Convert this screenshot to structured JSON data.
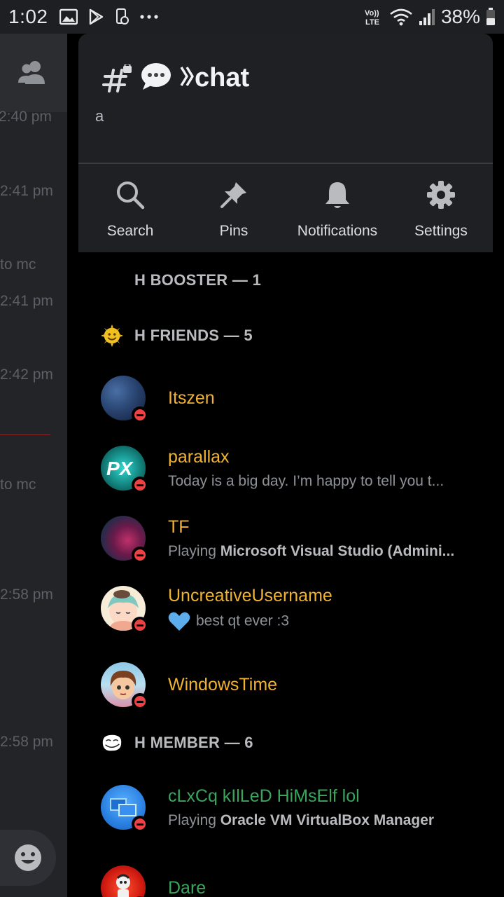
{
  "status_bar": {
    "time": "1:02",
    "battery_percent": "38%",
    "network_label": "Vo)) LTE"
  },
  "background_pane": {
    "timestamps": [
      "2:40 pm",
      "2:41 pm",
      "to mc",
      "2:41 pm",
      "2:42 pm",
      "to mc",
      "2:58 pm",
      "2:58 pm"
    ]
  },
  "channel": {
    "title": "chat",
    "topic": "a"
  },
  "actions": [
    {
      "label": "Search",
      "icon": "search-icon"
    },
    {
      "label": "Pins",
      "icon": "pin-icon"
    },
    {
      "label": "Notifications",
      "icon": "bell-icon"
    },
    {
      "label": "Settings",
      "icon": "gear-icon"
    }
  ],
  "groups": [
    {
      "title": "H BOOSTER — 1",
      "members": []
    },
    {
      "title": "H FRIENDS — 5",
      "members": [
        {
          "name": "Itszen",
          "activity": "",
          "activity_bold": ""
        },
        {
          "name": "parallax",
          "activity": "Today is a big day. I’m happy to tell you t...",
          "activity_bold": ""
        },
        {
          "name": "TF",
          "activity": "Playing ",
          "activity_bold": "Microsoft Visual Studio (Admini..."
        },
        {
          "name": "UncreativeUsername",
          "activity": "best qt ever :3",
          "activity_bold": ""
        },
        {
          "name": "WindowsTime",
          "activity": "",
          "activity_bold": ""
        }
      ]
    },
    {
      "title": "H MEMBER — 6",
      "members": [
        {
          "name": "cLxCq kIlLeD HiMsElf lol",
          "activity": "Playing ",
          "activity_bold": "Oracle VM VirtualBox Manager"
        },
        {
          "name": "Dare",
          "activity": "",
          "activity_bold": ""
        }
      ]
    }
  ],
  "colors": {
    "friend_name": "#f0b232",
    "member_name": "#3ba55c",
    "dnd_status": "#ed4245"
  }
}
